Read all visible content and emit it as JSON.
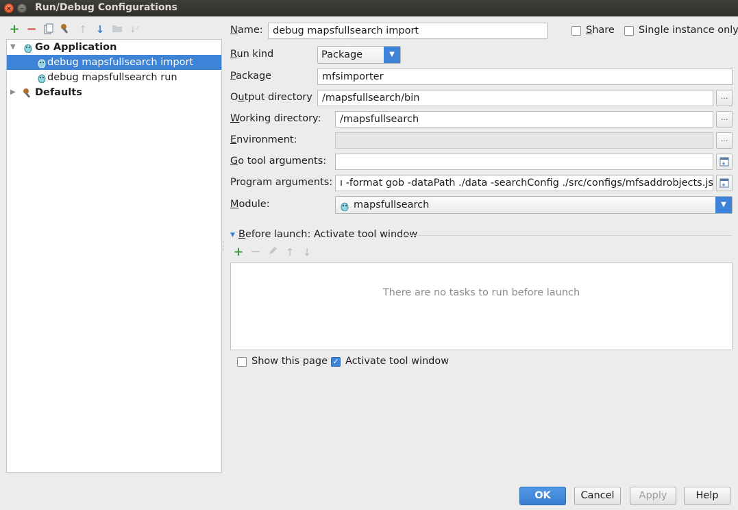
{
  "window": {
    "title": "Run/Debug Configurations",
    "close_glyph": "×",
    "minimize_glyph": "–"
  },
  "toolbar": {
    "icons": [
      "add-icon",
      "remove-icon",
      "copy-icon",
      "edit-defaults-icon",
      "move-up-icon",
      "move-down-icon",
      "folder-icon",
      "sort-icon"
    ],
    "glyphs": {
      "add": "+",
      "remove": "−",
      "up": "↑",
      "down": "↓",
      "sort": "↓ᶻ"
    }
  },
  "tree": {
    "group_label": "Go Application",
    "items": [
      {
        "label": "debug mapsfullsearch import",
        "selected": true
      },
      {
        "label": "debug mapsfullsearch run",
        "selected": false
      }
    ],
    "defaults_label": "Defaults"
  },
  "form": {
    "name": {
      "label_u": "N",
      "label_rest": "ame:",
      "value": "debug mapsfullsearch import"
    },
    "share": {
      "label_u": "S",
      "label_rest": "hare",
      "checked": false
    },
    "single_instance": {
      "label_u": "",
      "label_rest": "Single instance only",
      "checked": false
    },
    "run_kind": {
      "label_u": "R",
      "label_rest": "un kind",
      "value": "Package"
    },
    "package": {
      "label_u": "P",
      "label_rest": "ackage",
      "value": "mfsimporter"
    },
    "output_dir": {
      "label_pre": "O",
      "label_u": "u",
      "label_rest": "tput directory",
      "value": "/mapsfullsearch/bin"
    },
    "working_dir": {
      "label_u": "W",
      "label_rest": "orking directory:",
      "value": "/mapsfullsearch"
    },
    "environment": {
      "label_u": "E",
      "label_rest": "nvironment:",
      "value": ""
    },
    "go_tool_args": {
      "label_u": "G",
      "label_rest": "o tool arguments:",
      "value": ""
    },
    "program_args": {
      "label_pre": "Pro",
      "label_u": "g",
      "label_rest": "ram arguments:",
      "value": "ı -format gob -dataPath ./data -searchConfig ./src/configs/mfsaddrobjects.json"
    },
    "module": {
      "label_u": "M",
      "label_rest": "odule:",
      "value": "mapsfullsearch"
    },
    "browse_glyph": "..."
  },
  "before_launch": {
    "header_u": "B",
    "header_rest": "efore launch: Activate tool window",
    "empty_message": "There are no tasks to run before launch",
    "show_this_page": {
      "label": "Show this page",
      "checked": false
    },
    "activate_tool_window": {
      "label": "Activate tool window",
      "checked": true
    }
  },
  "buttons": {
    "ok": "OK",
    "cancel": "Cancel",
    "apply": "Apply",
    "help": "Help"
  },
  "colors": {
    "accent": "#3d83d8",
    "add_green": "#3a9a3a",
    "remove_red": "#d64a3a"
  }
}
